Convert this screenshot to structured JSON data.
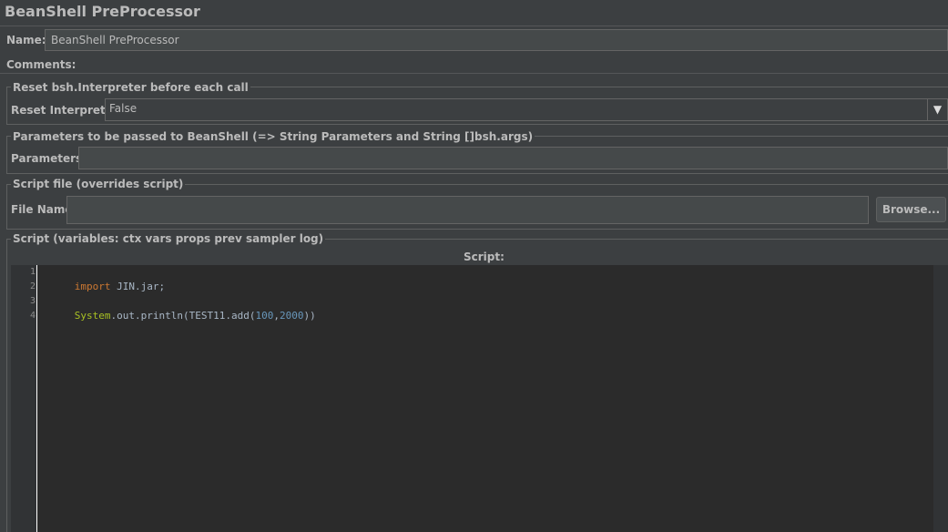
{
  "panel_title": "BeanShell PreProcessor",
  "name_field": {
    "label": "Name:",
    "value": "BeanShell PreProcessor"
  },
  "comments_field": {
    "label": "Comments:",
    "value": ""
  },
  "reset_group": {
    "legend": "Reset bsh.Interpreter before each call",
    "label": "Reset Interpreter:",
    "selected": "False",
    "arrow": "▼"
  },
  "params_group": {
    "legend": "Parameters to be passed to BeanShell (=> String Parameters and String []bsh.args)",
    "label": "Parameters:",
    "value": ""
  },
  "file_group": {
    "legend": "Script file (overrides script)",
    "label": "File Name:",
    "value": "",
    "browse_label": "Browse..."
  },
  "script_group": {
    "legend": "Script (variables: ctx vars props prev sampler log)",
    "header": "Script:",
    "line_numbers": [
      "1",
      "2",
      "3",
      "4"
    ],
    "lines": [
      {
        "tokens": [
          {
            "t": "import",
            "c": "kw"
          },
          {
            "t": " JIN.jar;",
            "c": "plain"
          }
        ]
      },
      {
        "tokens": []
      },
      {
        "tokens": [
          {
            "t": "System",
            "c": "cls"
          },
          {
            "t": ".out.println(TEST11.add(",
            "c": "plain"
          },
          {
            "t": "100",
            "c": "num"
          },
          {
            "t": ",",
            "c": "plain"
          },
          {
            "t": "2000",
            "c": "num"
          },
          {
            "t": "))",
            "c": "plain"
          }
        ]
      },
      {
        "tokens": []
      }
    ]
  },
  "colors": {
    "background": "#3c3f41",
    "editor_background": "#2b2b2b",
    "keyword": "#cc7832",
    "class_name": "#a8c023",
    "number": "#6897bb",
    "text": "#bbbbbb"
  }
}
